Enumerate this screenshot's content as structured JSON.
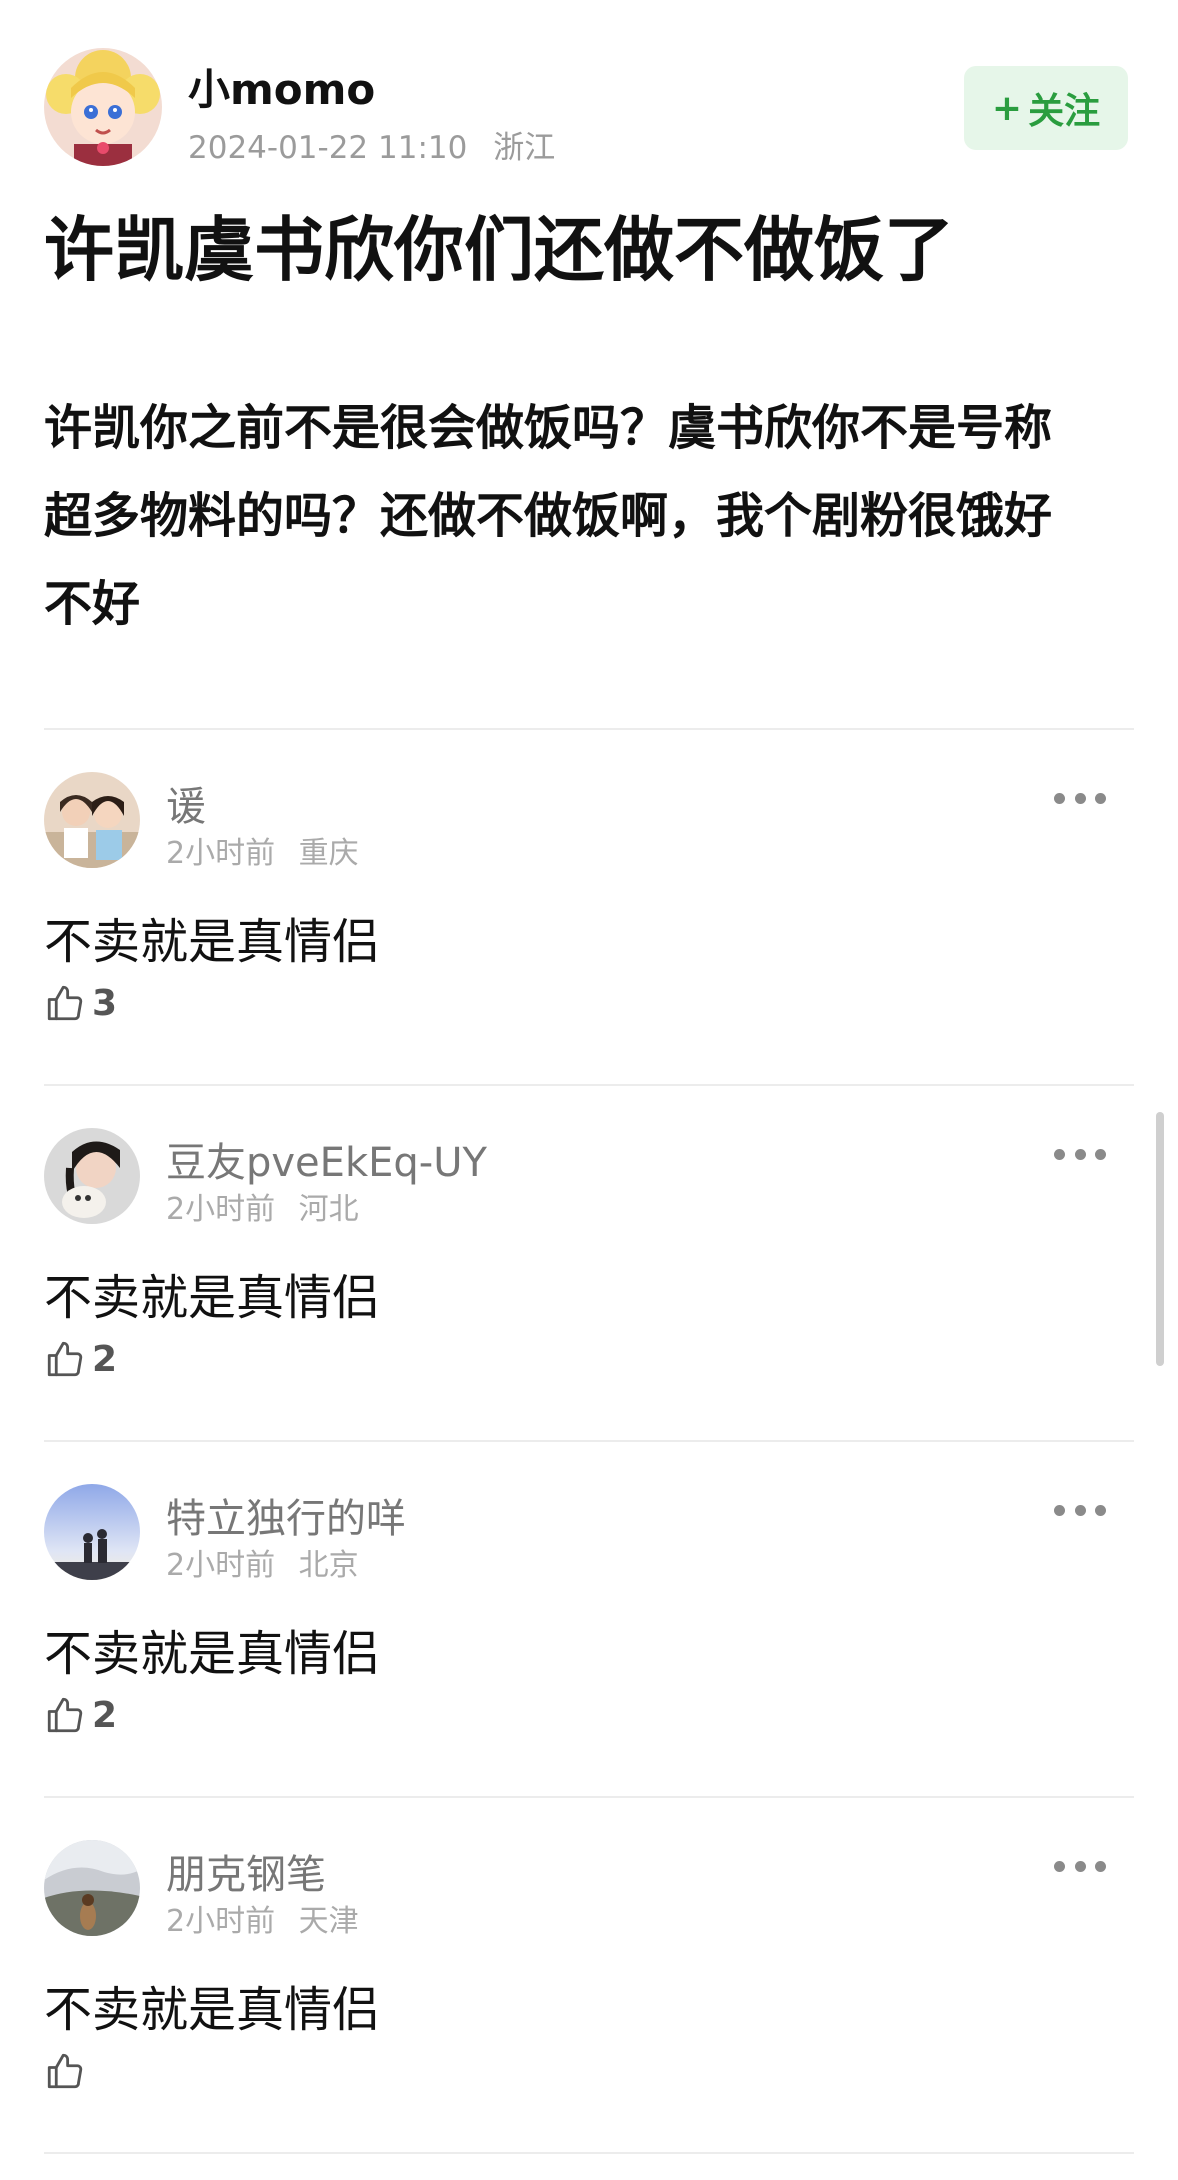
{
  "post": {
    "author": "小momo",
    "datetime": "2024-01-22 11:10",
    "location": "浙江",
    "follow_label": "关注",
    "follow_plus": "+",
    "title": "许凯虞书欣你们还做不做饭了",
    "body": "许凯你之前不是很会做饭吗？虞书欣你不是号称超多物料的吗？还做不做饭啊，我个剧粉很饿好不好"
  },
  "comments": [
    {
      "user": "谖",
      "time": "2小时前",
      "location": "重庆",
      "text": "不卖就是真情侣",
      "likes": "3",
      "avatar_icon": "two-girls-photo-avatar"
    },
    {
      "user": "豆友pveEkEq-UY",
      "time": "2小时前",
      "location": "河北",
      "text": "不卖就是真情侣",
      "likes": "2",
      "avatar_icon": "girl-with-pet-avatar"
    },
    {
      "user": "特立独行的咩",
      "time": "2小时前",
      "location": "北京",
      "text": "不卖就是真情侣",
      "likes": "2",
      "avatar_icon": "sky-silhouette-avatar"
    },
    {
      "user": "朋克钢笔",
      "time": "2小时前",
      "location": "天津",
      "text": "不卖就是真情侣",
      "likes": "",
      "avatar_icon": "landscape-avatar"
    }
  ],
  "colors": {
    "follow_bg": "#e6f6e9",
    "follow_text": "#2a9d3f",
    "meta_gray": "#9b9b9b",
    "username_gray": "#777777"
  },
  "icons": {
    "like": "thumbs-up-icon",
    "more": "more-dots-icon"
  }
}
